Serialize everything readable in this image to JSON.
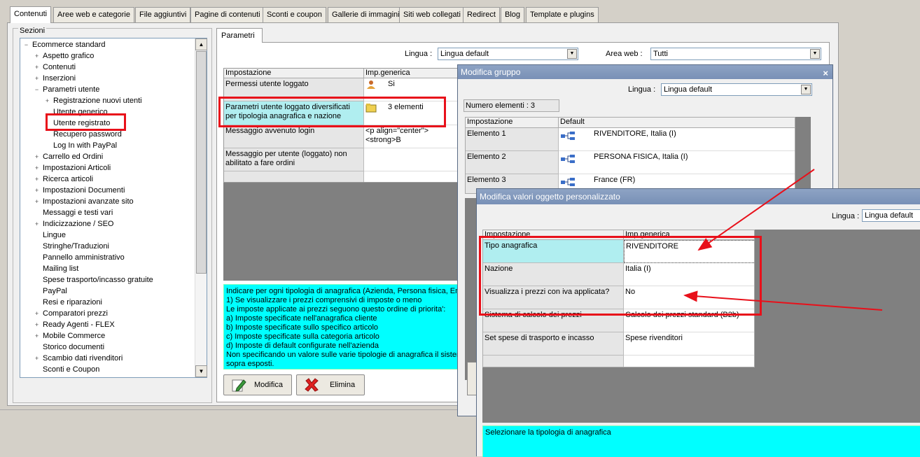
{
  "tabs": [
    "Contenuti",
    "Aree web e categorie",
    "File aggiuntivi",
    "Pagine di contenuti",
    "Sconti e coupon",
    "Gallerie di immagini",
    "Siti web collegati",
    "Redirect",
    "Blog",
    "Template e plugins"
  ],
  "sections": {
    "title": "Sezioni",
    "tree": [
      {
        "label": "Ecommerce standard",
        "level": 0,
        "exp": "−"
      },
      {
        "label": "Aspetto grafico",
        "level": 1,
        "exp": "+"
      },
      {
        "label": "Contenuti",
        "level": 1,
        "exp": "+"
      },
      {
        "label": "Inserzioni",
        "level": 1,
        "exp": "+"
      },
      {
        "label": "Parametri utente",
        "level": 1,
        "exp": "−"
      },
      {
        "label": "Registrazione nuovi utenti",
        "level": 2,
        "exp": "+"
      },
      {
        "label": "Utente generico",
        "level": 2,
        "exp": ""
      },
      {
        "label": "Utente registrato",
        "level": 2,
        "exp": ""
      },
      {
        "label": "Recupero password",
        "level": 2,
        "exp": ""
      },
      {
        "label": "Log In with PayPal",
        "level": 2,
        "exp": ""
      },
      {
        "label": "Carrello ed Ordini",
        "level": 1,
        "exp": "+"
      },
      {
        "label": "Impostazioni Articoli",
        "level": 1,
        "exp": "+"
      },
      {
        "label": "Ricerca articoli",
        "level": 1,
        "exp": "+"
      },
      {
        "label": "Impostazioni Documenti",
        "level": 1,
        "exp": "+"
      },
      {
        "label": "Impostazioni avanzate sito",
        "level": 1,
        "exp": "+"
      },
      {
        "label": "Messaggi e testi vari",
        "level": 1,
        "exp": ""
      },
      {
        "label": "Indicizzazione / SEO",
        "level": 1,
        "exp": "+"
      },
      {
        "label": "Lingue",
        "level": 1,
        "exp": ""
      },
      {
        "label": "Stringhe/Traduzioni",
        "level": 1,
        "exp": ""
      },
      {
        "label": "Pannello amministrativo",
        "level": 1,
        "exp": ""
      },
      {
        "label": "Mailing list",
        "level": 1,
        "exp": ""
      },
      {
        "label": "Spese trasporto/incasso gratuite",
        "level": 1,
        "exp": ""
      },
      {
        "label": "PayPal",
        "level": 1,
        "exp": ""
      },
      {
        "label": "Resi e riparazioni",
        "level": 1,
        "exp": ""
      },
      {
        "label": "Comparatori prezzi",
        "level": 1,
        "exp": "+"
      },
      {
        "label": "Ready Agenti - FLEX",
        "level": 1,
        "exp": "+"
      },
      {
        "label": "Mobile Commerce",
        "level": 1,
        "exp": "+"
      },
      {
        "label": "Storico documenti",
        "level": 1,
        "exp": ""
      },
      {
        "label": "Scambio dati rivenditori",
        "level": 1,
        "exp": "+"
      },
      {
        "label": "Sconti e Coupon",
        "level": 1,
        "exp": ""
      }
    ]
  },
  "parametri": {
    "tab": "Parametri",
    "lingua_label": "Lingua :",
    "lingua_value": "Lingua default",
    "area_label": "Area web :",
    "area_value": "Tutti",
    "col1": "Impostazione",
    "col2": "Imp.generica",
    "rows": [
      {
        "name": "Permessi utente loggato",
        "value": "Si"
      },
      {
        "name": "Parametri utente loggato diversificati per tipologia anagrafica e nazione",
        "value": "3 elementi"
      },
      {
        "name": "Messaggio avvenuto login",
        "value": "<p align=\"center\"><strong>B"
      },
      {
        "name": "Messaggio per utente (loggato) non abilitato a fare ordini",
        "value": ""
      }
    ],
    "info_lines": [
      "Indicare per ogni tipologia di anagrafica (Azienda, Persona fisica, Ent",
      "1) Se visualizzare i prezzi comprensivi di imposte o meno",
      "Le imposte applicate ai prezzi seguono questo ordine di priorita':",
      "a) Imposte specificate nell'anagrafica cliente",
      "b) Imposte specificate sullo specifico articolo",
      "c) Imposte specificate sulla categoria articolo",
      "d) Imposte di default configurate nell'azienda",
      "Non specificando un valore sulle varie tipologie di anagrafica il sistema",
      "sopra esposti."
    ],
    "btn_modifica": "Modifica",
    "btn_elimina": "Elimina"
  },
  "gruppo": {
    "title": "Modifica gruppo",
    "close": "×",
    "lingua_label": "Lingua :",
    "lingua_value": "Lingua default",
    "count": "Numero elementi : 3",
    "col1": "Impostazione",
    "col2": "Default",
    "rows": [
      {
        "name": "Elemento 1",
        "value": "RIVENDITORE, Italia (I)"
      },
      {
        "name": "Elemento 2",
        "value": "PERSONA FISICA, Italia (I)"
      },
      {
        "name": "Elemento 3",
        "value": "France (FR)"
      }
    ]
  },
  "valori": {
    "title": "Modifica valori oggetto personalizzato",
    "lingua_label": "Lingua :",
    "lingua_value": "Lingua default",
    "col1": "Impostazione",
    "col2": "Imp.generica",
    "rows": [
      {
        "name": "Tipo anagrafica",
        "value": "RIVENDITORE"
      },
      {
        "name": "Nazione",
        "value": "Italia (I)"
      },
      {
        "name": "Visualizza i prezzi con iva applicata?",
        "value": "No"
      },
      {
        "name": "Sistema di calcolo dei prezzi",
        "value": "Calcolo dei prezzi standard (B2b)"
      },
      {
        "name": "Set spese di trasporto e incasso",
        "value": "Spese rivenditori"
      }
    ],
    "info": "Selezionare la tipologia di anagrafica"
  },
  "colors": {
    "highlight_red": "#e8101a",
    "selected_cell": "#b0eef0",
    "info_cyan": "#00ffff",
    "title_bar": "#7890b6"
  },
  "icons": {
    "user": "user-icon",
    "folder": "folder-icon",
    "network": "network-icon",
    "edit": "pencil-icon",
    "delete": "red-x-icon"
  }
}
